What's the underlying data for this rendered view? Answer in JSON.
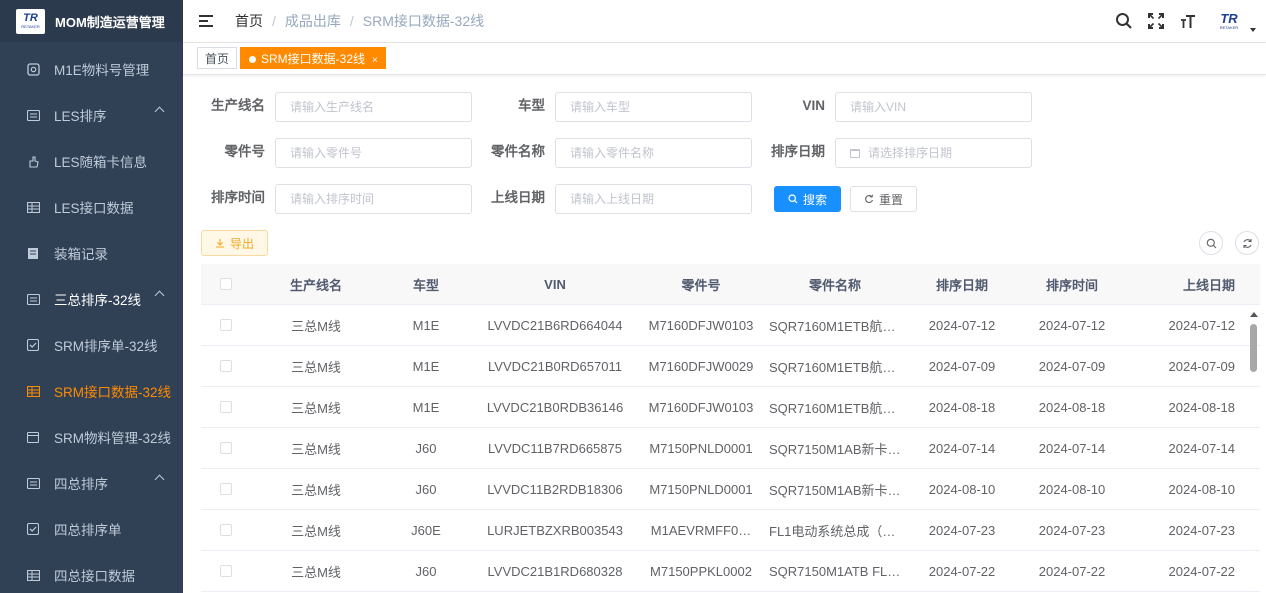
{
  "app": {
    "title": "MOM制造运营管理",
    "logo_text": "TR",
    "logo_sub": "RETAKER"
  },
  "sidebar": {
    "items": [
      {
        "label": "M1E物料号管理",
        "icon": "box-icon"
      },
      {
        "label": "LES排序",
        "icon": "list-icon"
      },
      {
        "label": "LES随箱卡信息",
        "icon": "hand-icon"
      },
      {
        "label": "LES接口数据",
        "icon": "grid-icon"
      },
      {
        "label": "装箱记录",
        "icon": "doc-icon"
      },
      {
        "label": "三总排序-32线",
        "icon": "list-icon"
      },
      {
        "label": "SRM排序单-32线",
        "icon": "check-icon"
      },
      {
        "label": "SRM接口数据-32线",
        "icon": "grid-icon"
      },
      {
        "label": "SRM物料管理-32线",
        "icon": "calendar-icon"
      },
      {
        "label": "四总排序",
        "icon": "list-icon"
      },
      {
        "label": "四总排序单",
        "icon": "check-icon"
      },
      {
        "label": "四总接口数据",
        "icon": "grid-icon"
      }
    ]
  },
  "breadcrumb": [
    "首页",
    "成品出库",
    "SRM接口数据-32线"
  ],
  "tags": {
    "home": "首页",
    "active": "SRM接口数据-32线",
    "close": "×"
  },
  "form": {
    "line_name": {
      "label": "生产线名",
      "placeholder": "请输入生产线名"
    },
    "car_type": {
      "label": "车型",
      "placeholder": "请输入车型"
    },
    "vin": {
      "label": "VIN",
      "placeholder": "请输入VIN"
    },
    "part_no": {
      "label": "零件号",
      "placeholder": "请输入零件号"
    },
    "part_name": {
      "label": "零件名称",
      "placeholder": "请输入零件名称"
    },
    "sort_date": {
      "label": "排序日期",
      "placeholder": "请选择排序日期"
    },
    "sort_time": {
      "label": "排序时间",
      "placeholder": "请输入排序时间"
    },
    "online_date": {
      "label": "上线日期",
      "placeholder": "请输入上线日期"
    },
    "search": "搜索",
    "reset": "重置"
  },
  "toolbar": {
    "export": "导出"
  },
  "table": {
    "columns": [
      "生产线名",
      "车型",
      "VIN",
      "零件号",
      "零件名称",
      "排序日期",
      "排序时间",
      "上线日期"
    ],
    "rows": [
      [
        "三总M线",
        "M1E",
        "LVVDC21B6RD664044",
        "M7160DFJW0103",
        "SQR7160M1ETB航空…",
        "2024-07-12",
        "2024-07-12",
        "2024-07-12"
      ],
      [
        "三总M线",
        "M1E",
        "LVVDC21B0RD657011",
        "M7160DFJW0029",
        "SQR7160M1ETB航空…",
        "2024-07-09",
        "2024-07-09",
        "2024-07-09"
      ],
      [
        "三总M线",
        "M1E",
        "LVVDC21B0RDB36146",
        "M7160DFJW0103",
        "SQR7160M1ETB航空…",
        "2024-08-18",
        "2024-08-18",
        "2024-08-18"
      ],
      [
        "三总M线",
        "J60",
        "LVVDC11B7RD665875",
        "M7150PNLD0001",
        "SQR7150M1AB新卡其…",
        "2024-07-14",
        "2024-07-14",
        "2024-07-14"
      ],
      [
        "三总M线",
        "J60",
        "LVVDC11B2RDB18306",
        "M7150PNLD0001",
        "SQR7150M1AB新卡其…",
        "2024-08-10",
        "2024-08-10",
        "2024-08-10"
      ],
      [
        "三总M线",
        "J60E",
        "LURJETBZXRB003543",
        "M1AEVRMFF0…",
        "FL1电动系统总成（版…",
        "2024-07-23",
        "2024-07-23",
        "2024-07-23"
      ],
      [
        "三总M线",
        "J60",
        "LVVDC21B1RD680328",
        "M7150PPKL0002",
        "SQR7150M1ATB FL2…",
        "2024-07-22",
        "2024-07-22",
        "2024-07-22"
      ]
    ]
  },
  "colors": {
    "sidebar_bg": "#304156",
    "accent": "#ff8a00",
    "primary": "#1890ff"
  }
}
